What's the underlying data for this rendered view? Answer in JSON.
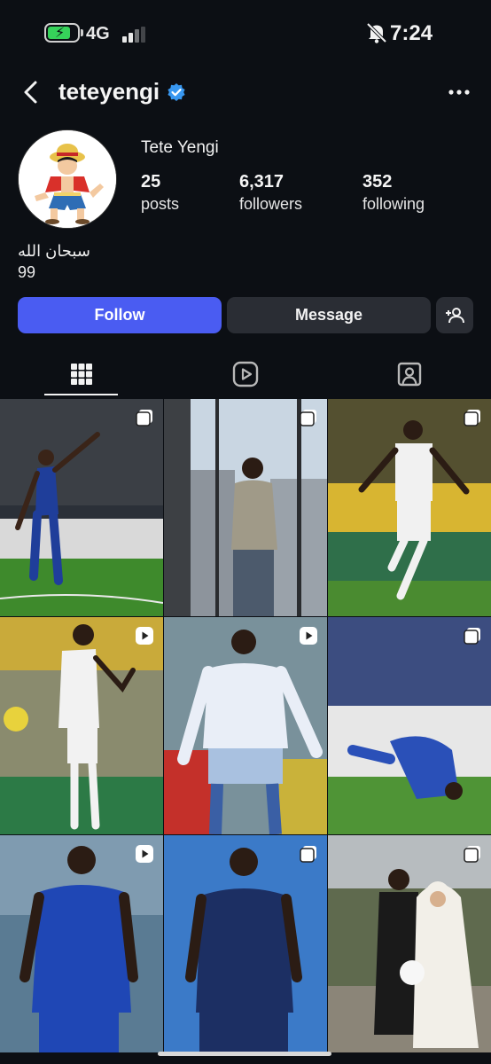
{
  "status_bar": {
    "network": "4G",
    "time": "7:24",
    "battery_level": 0.8
  },
  "header": {
    "username": "teteyengi",
    "verified": true
  },
  "profile": {
    "display_name": "Tete Yengi",
    "stats": [
      {
        "value": "25",
        "label": "posts"
      },
      {
        "value": "6,317",
        "label": "followers"
      },
      {
        "value": "352",
        "label": "following"
      }
    ],
    "bio": [
      "سبحان الله",
      "99"
    ]
  },
  "actions": {
    "follow": "Follow",
    "message": "Message"
  },
  "tabs": [
    {
      "icon": "grid-icon",
      "active": true
    },
    {
      "icon": "reels-icon",
      "active": false
    },
    {
      "icon": "tagged-icon",
      "active": false
    }
  ],
  "posts": [
    {
      "badge": "carousel-icon"
    },
    {
      "badge": "carousel-icon"
    },
    {
      "badge": "carousel-icon"
    },
    {
      "badge": "reel-icon"
    },
    {
      "badge": "reel-icon"
    },
    {
      "badge": "carousel-icon"
    },
    {
      "badge": "reel-icon"
    },
    {
      "badge": "carousel-icon"
    },
    {
      "badge": "carousel-icon"
    }
  ],
  "colors": {
    "background": "#0c0f14",
    "follow_button": "#4a5cf2",
    "secondary_button": "#2a2d34",
    "verified": "#3897f0",
    "battery": "#36d25a"
  }
}
